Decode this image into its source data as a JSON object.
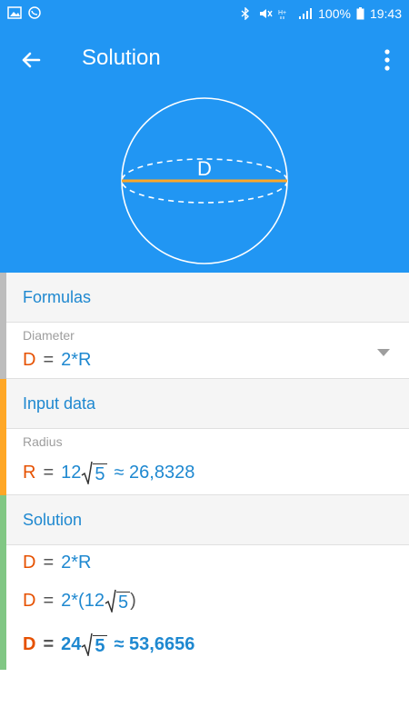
{
  "status_bar": {
    "battery": "100%",
    "time": "19:43"
  },
  "app_bar": {
    "title": "Solution"
  },
  "figure": {
    "label": "D"
  },
  "colors": {
    "primary": "#2196F3",
    "orange": "#e65100",
    "blue": "#1e88d0",
    "bar_formulas": "#bdbdbd",
    "bar_input": "#FFA726",
    "bar_solution": "#81C784",
    "diameter_line": "#FFA726"
  },
  "formulas": {
    "header": "Formulas",
    "label": "Diameter",
    "lhs": "D",
    "eq": "=",
    "rhs": "2*R"
  },
  "input_data": {
    "header": "Input data",
    "label": "Radius",
    "lhs": "R",
    "eq": "=",
    "coef": "12",
    "radicand": "5",
    "approx": "≈ 26,8328"
  },
  "solution": {
    "header": "Solution",
    "step1": {
      "lhs": "D",
      "eq": "=",
      "rhs": "2*R"
    },
    "step2": {
      "lhs": "D",
      "eq": "=",
      "prefix": "2*(",
      "coef": "12",
      "radicand": "5",
      "suffix": ")"
    },
    "result": {
      "lhs": "D",
      "eq": "=",
      "coef": "24",
      "radicand": "5",
      "approx": "≈ 53,6656"
    }
  }
}
